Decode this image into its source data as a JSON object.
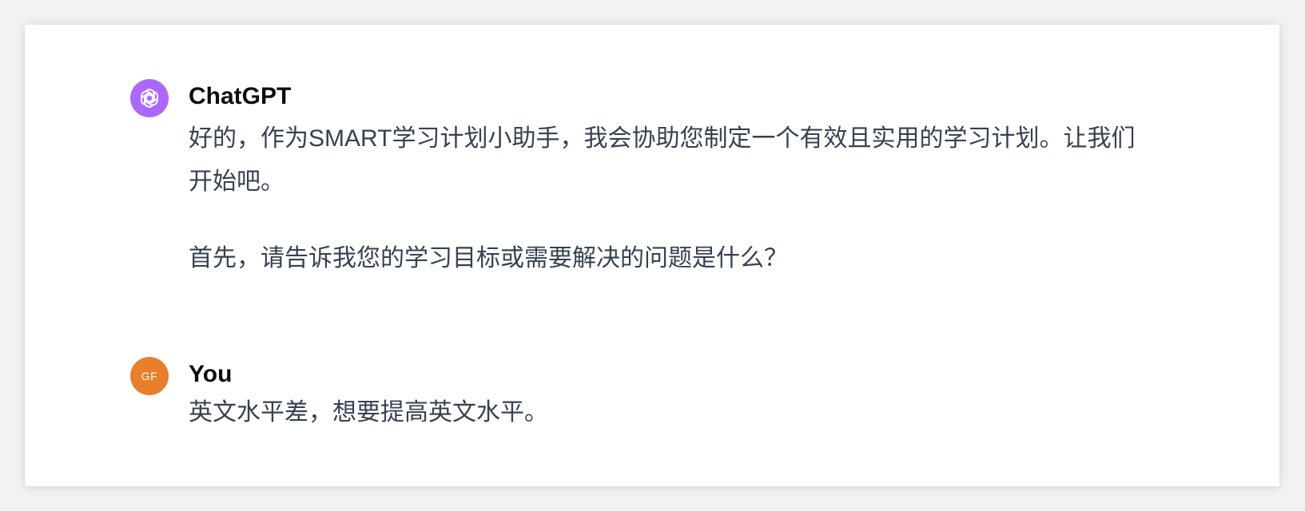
{
  "conversation": {
    "assistant": {
      "author": "ChatGPT",
      "avatar_icon": "openai-logo-icon",
      "avatar_color": "#ab68ff",
      "paragraphs": [
        "好的，作为SMART学习计划小助手，我会协助您制定一个有效且实用的学习计划。让我们开始吧。",
        "首先，请告诉我您的学习目标或需要解决的问题是什么？"
      ]
    },
    "user": {
      "author": "You",
      "avatar_initials": "GF",
      "avatar_color": "#e87f2a",
      "paragraphs": [
        "英文水平差，想要提高英文水平。"
      ]
    }
  }
}
